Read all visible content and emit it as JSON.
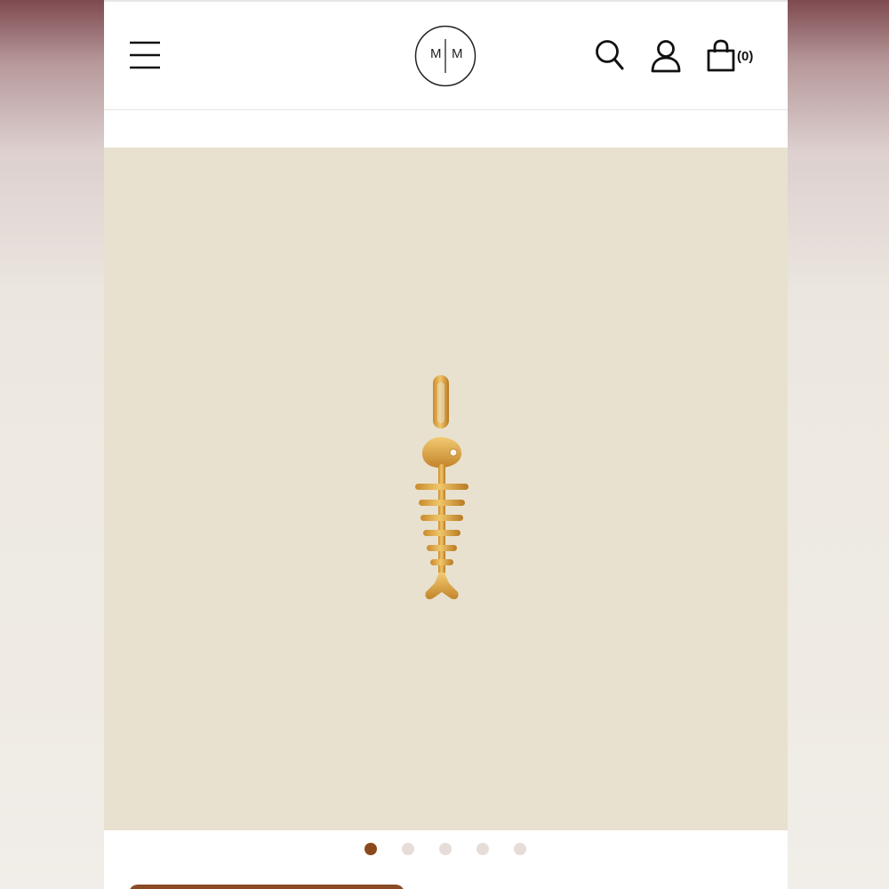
{
  "header": {
    "menu_icon": "hamburger-menu-icon",
    "logo": {
      "letters": [
        "M",
        "M"
      ],
      "icon": "brand-monogram-logo"
    },
    "search_icon": "search-icon",
    "account_icon": "user-icon",
    "cart": {
      "icon": "shopping-bag-icon",
      "count": "(0)"
    }
  },
  "product": {
    "image": "fishbone-pendant-charm",
    "image_background": "#e8e1cf",
    "metal_color": "#d9a23e"
  },
  "carousel": {
    "total": 5,
    "active_index": 0,
    "active_color": "#8c4a1c",
    "inactive_color": "#e7ddd8"
  },
  "colors": {
    "accent": "#8a4b25",
    "header_bg": "#ffffff"
  }
}
